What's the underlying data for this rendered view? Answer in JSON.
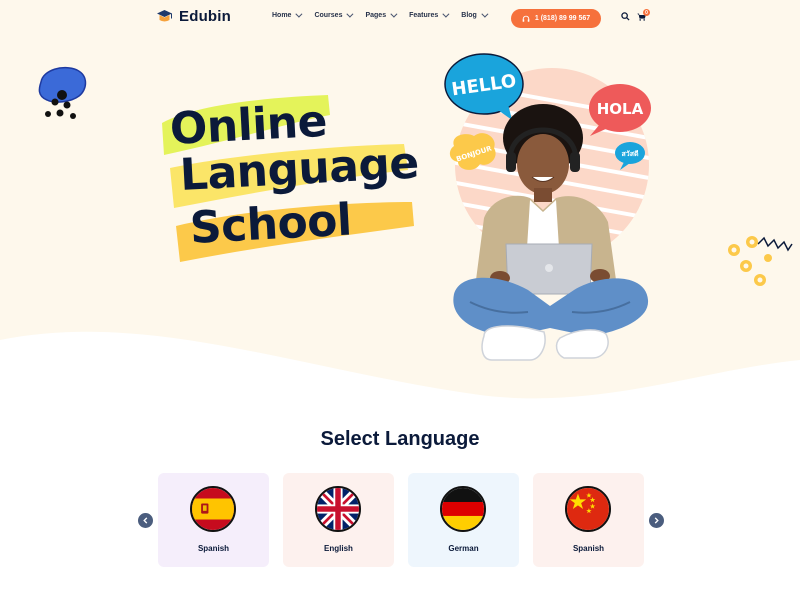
{
  "brand": {
    "name": "Edubin"
  },
  "nav": {
    "items": [
      {
        "label": "Home"
      },
      {
        "label": "Courses"
      },
      {
        "label": "Pages"
      },
      {
        "label": "Features"
      },
      {
        "label": "Blog"
      }
    ]
  },
  "header": {
    "phone_label": "1 (818) 89 99 567",
    "cart_count": "0"
  },
  "hero": {
    "line1": "Online",
    "line2": "Language",
    "line3": "School",
    "bubbles": [
      "HELLO",
      "HOLA",
      "BONJOUR",
      "สวัสดี"
    ]
  },
  "languages": {
    "title": "Select Language",
    "cards": [
      {
        "label": "Spanish",
        "bg": "#f5eefb",
        "flag": "spain"
      },
      {
        "label": "English",
        "bg": "#fdf1ee",
        "flag": "uk"
      },
      {
        "label": "German",
        "bg": "#eef6fd",
        "flag": "germany"
      },
      {
        "label": "Spanish",
        "bg": "#fdf1ee",
        "flag": "china"
      }
    ]
  },
  "colors": {
    "accent": "#f6713c",
    "navy": "#0b1a3a",
    "hero_bg": "#fef8ec",
    "highlight_green": "#e4f35a",
    "highlight_yellow": "#fcd34d"
  }
}
